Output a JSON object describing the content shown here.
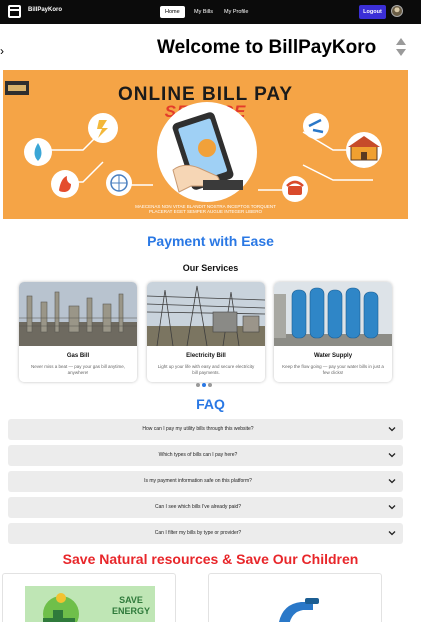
{
  "navbar": {
    "brand": "BillPayKoro",
    "links": [
      {
        "label": "Home",
        "active": true
      },
      {
        "label": "My Bills",
        "active": false
      },
      {
        "label": "My Profile",
        "active": false
      }
    ],
    "logout_label": "Logout",
    "accent": "#3b2fd6"
  },
  "welcome": {
    "arrow": "›",
    "title": "Welcome to BillPayKoro"
  },
  "banner": {
    "title": "ONLINE BILL PAY",
    "subtitle": "SERVICE",
    "footer_line1": "MAECENAS NON VITAE BLANDIT NOSTRA INCEPTOS TORQUENT",
    "footer_line2": "PLACERAT EGET SEMPER AUGUE INTEGER LIBERO"
  },
  "payment": {
    "title": "Payment with Ease",
    "title_color": "#2a78e4"
  },
  "services": {
    "title": "Our Services",
    "cards": [
      {
        "title": "Gas Bill",
        "description": "Never miss a beat — pay your gas bill anytime, anywhere!"
      },
      {
        "title": "Electricity Bill",
        "description": "Light up your life with easy and secure electricity bill payments."
      },
      {
        "title": "Water Supply",
        "description": "Keep the flow going — pay your water bills in just a few clicks!"
      }
    ]
  },
  "faq": {
    "title": "FAQ",
    "items": [
      {
        "question": "How can I pay my utility bills through this website?"
      },
      {
        "question": "Which types of bills can I pay here?"
      },
      {
        "question": "Is my payment information safe on this platform?"
      },
      {
        "question": "Can I see which bills I've already paid?"
      },
      {
        "question": "Can I filter my bills by type or provider?"
      }
    ]
  },
  "save": {
    "title": "Save Natural resources & Save Our Children",
    "title_color": "#e8262a",
    "poster_label_1": "SAVE",
    "poster_label_2": "ENERGY"
  }
}
